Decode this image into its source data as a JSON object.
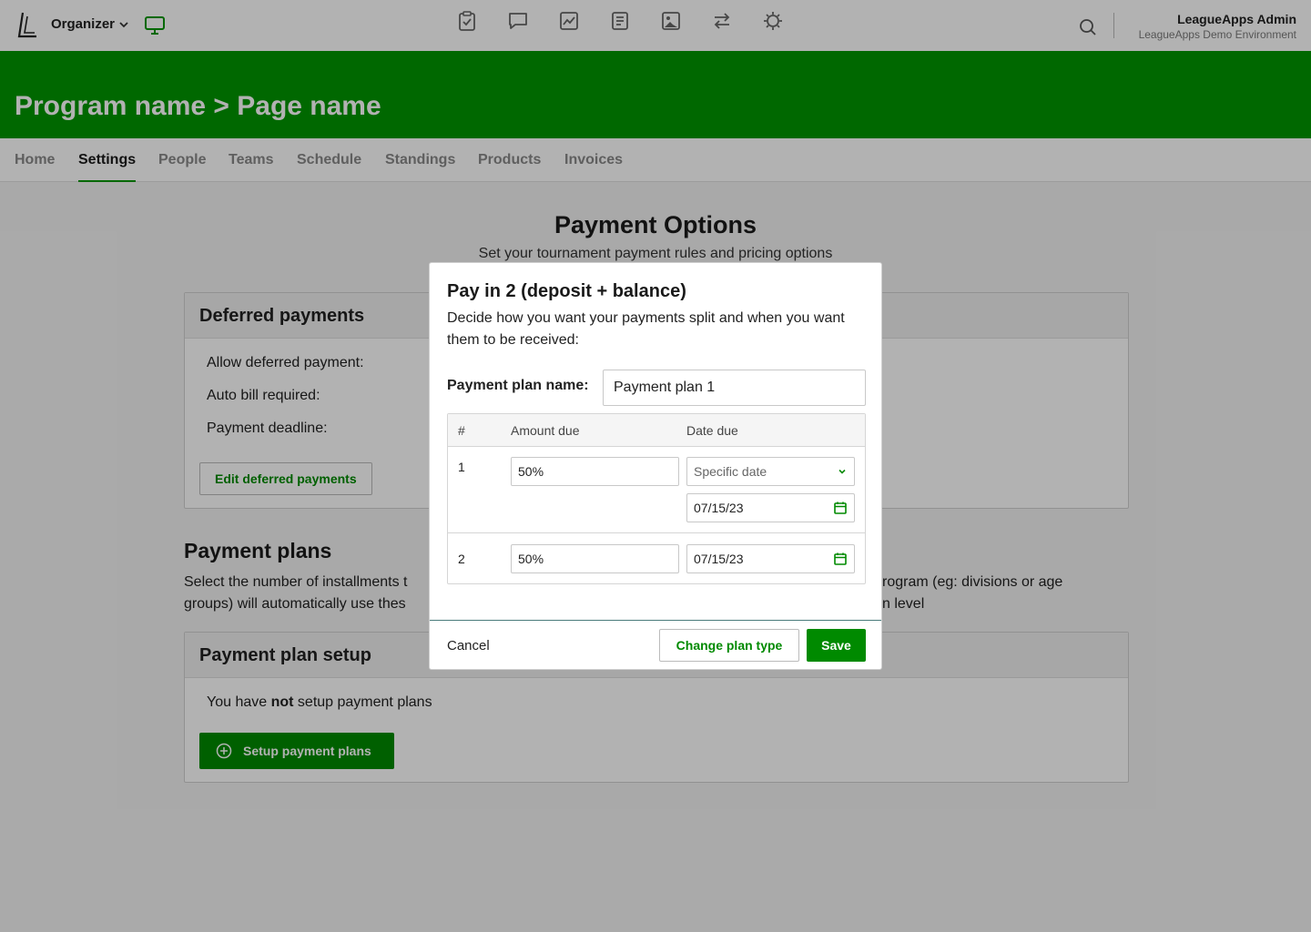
{
  "topbar": {
    "org_label": "Organizer",
    "user_name": "LeagueApps Admin",
    "user_env": "LeagueApps Demo Environment",
    "nav_icons": [
      "clipboard-check-icon",
      "chat-icon",
      "chart-icon",
      "document-icon",
      "image-icon",
      "transfer-icon",
      "settings-gear-icon"
    ]
  },
  "banner": {
    "title": "Program name > Page name"
  },
  "tabs": [
    "Home",
    "Settings",
    "People",
    "Teams",
    "Schedule",
    "Standings",
    "Products",
    "Invoices"
  ],
  "active_tab": "Settings",
  "main": {
    "title": "Payment Options",
    "subtitle": "Set your tournament payment rules and pricing options",
    "deferred": {
      "header": "Deferred payments",
      "rows": [
        "Allow deferred payment:",
        "Auto bill required:",
        "Payment deadline:"
      ],
      "edit_label": "Edit deferred payments"
    },
    "plans": {
      "heading": "Payment plans",
      "desc_left_1": "Select the number of installments t",
      "desc_right_1": "rogram (eg: divisions or age",
      "desc_left_2": "groups) will automatically use thes",
      "desc_right_2": "n level"
    },
    "setup": {
      "header": "Payment plan setup",
      "msg_pre": "You have ",
      "msg_bold": "not",
      "msg_post": " setup payment plans",
      "button_label": "Setup payment plans"
    }
  },
  "modal": {
    "title": "Pay in 2 (deposit + balance)",
    "description": "Decide how you want your payments split and when you want them to be received:",
    "plan_name_label": "Payment plan name:",
    "plan_name_value": "Payment plan 1",
    "columns": [
      "#",
      "Amount due",
      "Date due"
    ],
    "installments": [
      {
        "num": "1",
        "amount": "50%",
        "date_type": "Specific date",
        "date": "07/15/23"
      },
      {
        "num": "2",
        "amount": "50%",
        "date": "07/15/23"
      }
    ],
    "cancel_label": "Cancel",
    "change_label": "Change plan type",
    "save_label": "Save"
  },
  "colors": {
    "brand_green": "#009600",
    "button_green": "#008a00"
  }
}
